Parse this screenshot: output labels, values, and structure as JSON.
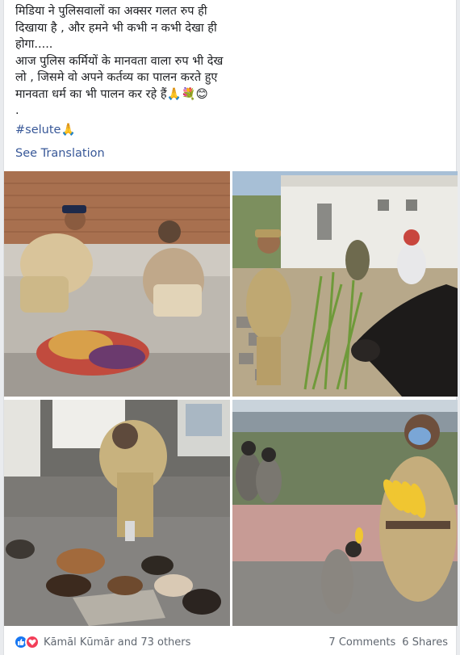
{
  "post": {
    "text_line1": "मिडिया ने पुलिसवालों का अक्सर गलत रुप ही",
    "text_line2": "दिखाया है , और हमने भी कभी न कभी देखा ही",
    "text_line3": "होगा.....",
    "text_line4": "आज पुलिस कर्मियों के मानवता वाला रुप भी देख",
    "text_line5": "लो , जिसमे वो अपने कर्तव्य का पालन करते हुए",
    "text_line6": "मानवता धर्म का भी पालन कर रहे हैं🙏💐😊",
    "text_line7": ".",
    "hashtag": "#selute🙏",
    "see_translation": "See Translation"
  },
  "photos": [
    {
      "icon": "photo-policewoman-feeding-elderly-man"
    },
    {
      "icon": "photo-policemen-feeding-cow"
    },
    {
      "icon": "photo-policeman-feeding-puppies"
    },
    {
      "icon": "photo-policeman-feeding-monkeys"
    }
  ],
  "footer": {
    "reactors": "Kāmāl Kūmār and 73 others",
    "comments": "7 Comments",
    "shares": "6 Shares"
  },
  "colors": {
    "link": "#385898",
    "like": "#1877f2",
    "love": "#f33e58",
    "meta_text": "#606770"
  }
}
